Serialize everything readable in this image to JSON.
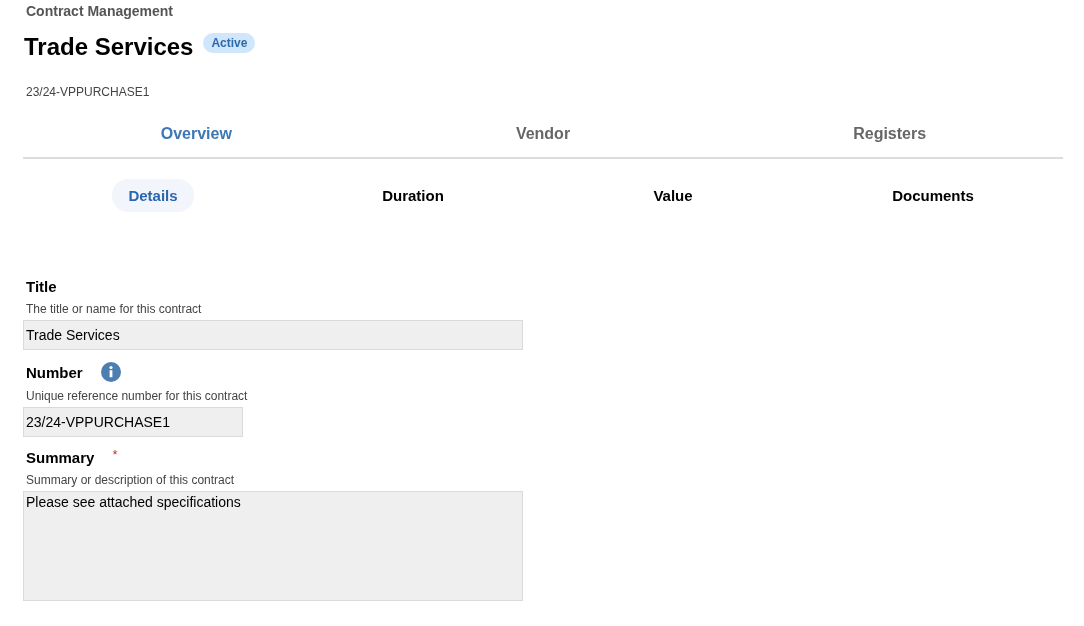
{
  "breadcrumb": "Contract Management",
  "header": {
    "title": "Trade Services",
    "status": "Active",
    "reference": "23/24-VPPURCHASE1"
  },
  "tabs": [
    {
      "label": "Overview",
      "selected": true
    },
    {
      "label": "Vendor",
      "selected": false
    },
    {
      "label": "Registers",
      "selected": false
    }
  ],
  "subtabs": [
    {
      "label": "Details",
      "selected": true
    },
    {
      "label": "Duration",
      "selected": false
    },
    {
      "label": "Value",
      "selected": false
    },
    {
      "label": "Documents",
      "selected": false
    }
  ],
  "fields": [
    {
      "kind": "text",
      "label": "Title",
      "hint": "The title or name for this contract",
      "value": "Trade Services",
      "info": false
    },
    {
      "kind": "short_text",
      "label": "Number",
      "hint": "Unique reference number for this contract",
      "value": "23/24-VPPURCHASE1",
      "info": true
    },
    {
      "kind": "textarea",
      "label": "Summary",
      "required_mark": "*",
      "hint": "Summary or description of this contract",
      "value": "Please see attached specifications",
      "info": false
    }
  ]
}
